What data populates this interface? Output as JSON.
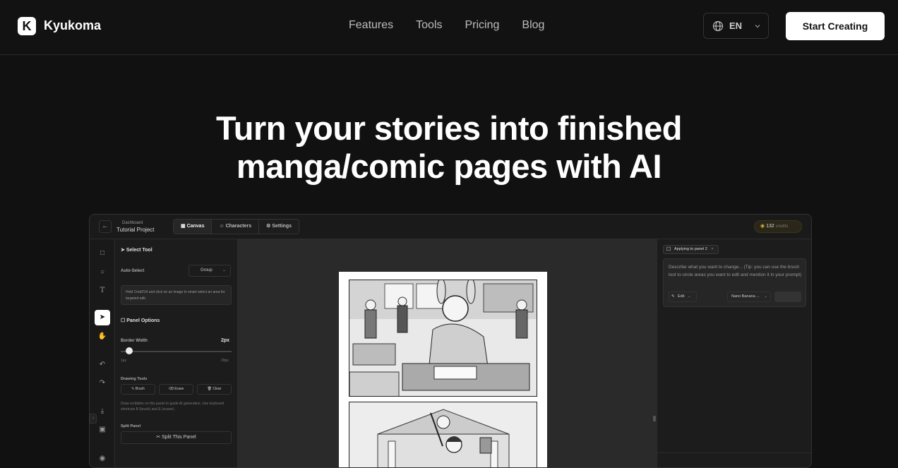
{
  "brand": {
    "logo_letter": "K",
    "name": "Kyukoma"
  },
  "nav": {
    "links": [
      "Features",
      "Tools",
      "Pricing",
      "Blog"
    ],
    "language": "EN",
    "cta": "Start Creating"
  },
  "hero": {
    "line1": "Turn your stories into finished",
    "line2": "manga/comic pages with AI"
  },
  "app": {
    "breadcrumb_parent": "Dashboard",
    "project_name": "Tutorial Project",
    "tabs": [
      "Canvas",
      "Characters",
      "Settings"
    ],
    "credits_value": "132",
    "credits_label": "credits",
    "select_tool_title": "Select Tool",
    "auto_select_label": "Auto-Select",
    "auto_select_value": "Group",
    "auto_select_hint": "Hold Cmd/Ctrl and click on an image to smart select an area for targeted edit.",
    "panel_options_title": "Panel Options",
    "border_width_label": "Border Width",
    "border_width_value": "2px",
    "border_width_min": "1px",
    "border_width_max": "20px",
    "border_width_level": 0.05,
    "drawing_tools_label": "Drawing Tools",
    "drawing_tools": [
      "Brush",
      "Erase",
      "Clear"
    ],
    "drawing_hint": "Draw scribbles on this panel to guide AI generation. Use keyboard shortcuts B (brush) and E (eraser).",
    "split_panel_label": "Split Panel",
    "split_panel_button": "Split This Panel",
    "applying_chip": "Applying to panel 2",
    "prompt_placeholder": "Describe what you want to change... (Tip: you can use the brush tool to circle areas you want to edit and mention it in your prompt)",
    "edit_label": "Edit",
    "model_label": "Nano Banana ..."
  }
}
